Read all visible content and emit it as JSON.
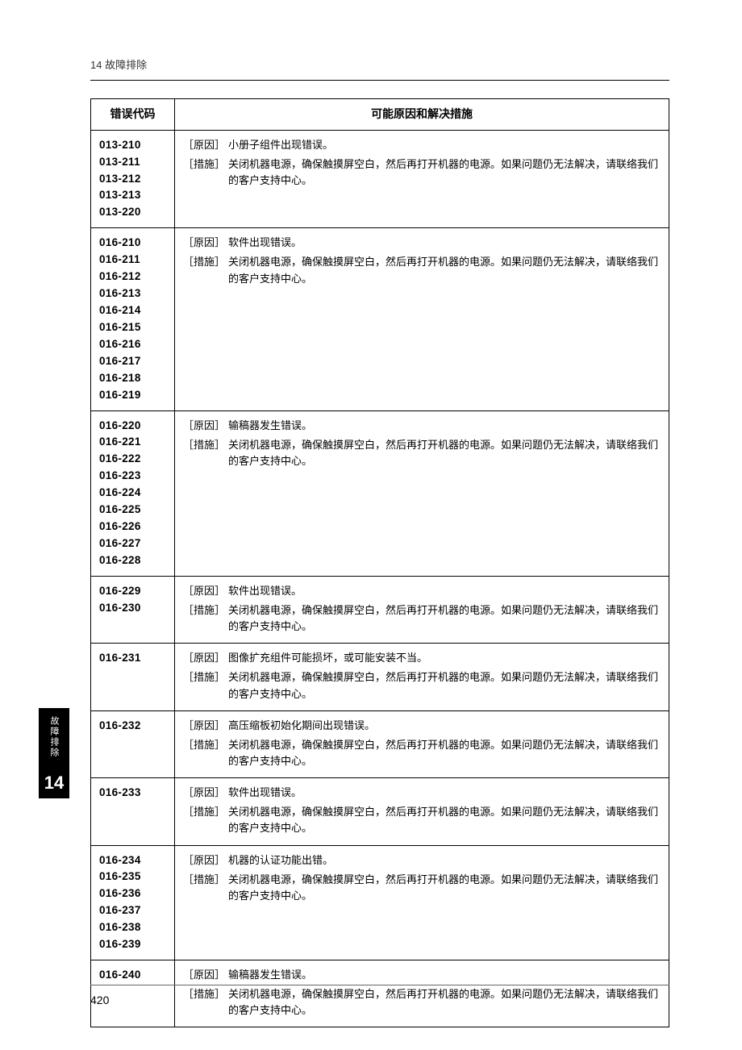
{
  "header": {
    "running": "14 故障排除"
  },
  "table": {
    "head": {
      "code": "错误代码",
      "desc": "可能原因和解决措施"
    },
    "labels": {
      "cause": "［原因］",
      "action": "［措施］"
    },
    "rows": [
      {
        "codes": "013-210\n013-211\n013-212\n013-213\n013-220",
        "cause": "小册子组件出现错误。",
        "action": "关闭机器电源，确保触摸屏空白，然后再打开机器的电源。如果问题仍无法解决，请联络我们的客户支持中心。"
      },
      {
        "codes": "016-210\n016-211\n016-212\n016-213\n016-214\n016-215\n016-216\n016-217\n016-218\n016-219",
        "cause": "软件出现错误。",
        "action": "关闭机器电源，确保触摸屏空白，然后再打开机器的电源。如果问题仍无法解决，请联络我们的客户支持中心。"
      },
      {
        "codes": "016-220\n016-221\n016-222\n016-223\n016-224\n016-225\n016-226\n016-227\n016-228",
        "cause": "输稿器发生错误。",
        "action": "关闭机器电源，确保触摸屏空白，然后再打开机器的电源。如果问题仍无法解决，请联络我们的客户支持中心。"
      },
      {
        "codes": "016-229\n016-230",
        "cause": "软件出现错误。",
        "action": "关闭机器电源，确保触摸屏空白，然后再打开机器的电源。如果问题仍无法解决，请联络我们的客户支持中心。"
      },
      {
        "codes": "016-231",
        "cause": "图像扩充组件可能损坏，或可能安装不当。",
        "action": "关闭机器电源，确保触摸屏空白，然后再打开机器的电源。如果问题仍无法解决，请联络我们的客户支持中心。"
      },
      {
        "codes": "016-232",
        "cause": "高压缩板初始化期间出现错误。",
        "action": "关闭机器电源，确保触摸屏空白，然后再打开机器的电源。如果问题仍无法解决，请联络我们的客户支持中心。"
      },
      {
        "codes": "016-233",
        "cause": "软件出现错误。",
        "action": "关闭机器电源，确保触摸屏空白，然后再打开机器的电源。如果问题仍无法解决，请联络我们的客户支持中心。"
      },
      {
        "codes": "016-234\n016-235\n016-236\n016-237\n016-238\n016-239",
        "cause": "机器的认证功能出错。",
        "action": "关闭机器电源，确保触摸屏空白，然后再打开机器的电源。如果问题仍无法解决，请联络我们的客户支持中心。"
      },
      {
        "codes": "016-240",
        "cause": "输稿器发生错误。",
        "action": "关闭机器电源，确保触摸屏空白，然后再打开机器的电源。如果问题仍无法解决，请联络我们的客户支持中心。"
      }
    ]
  },
  "side": {
    "label": "故障排除",
    "number": "14"
  },
  "page_number": "420"
}
